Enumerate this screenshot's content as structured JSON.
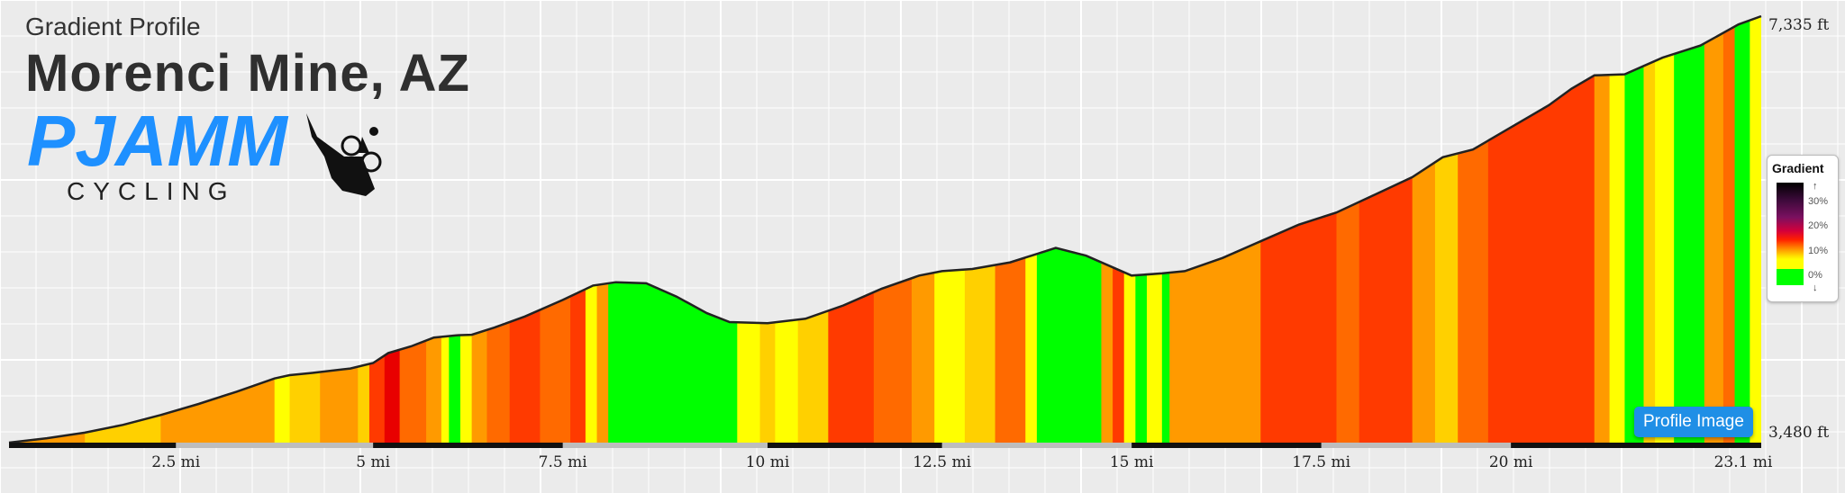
{
  "header": {
    "subtitle": "Gradient Profile",
    "title": "Morenci Mine, AZ"
  },
  "logo": {
    "brand": "PJAMM",
    "tag": "CYCLING"
  },
  "legend": {
    "title": "Gradient",
    "labels": [
      "30%",
      "20%",
      "10%",
      "0%"
    ],
    "up_arrow": "↑",
    "down_arrow": "↓"
  },
  "button": {
    "label": "Profile Image"
  },
  "colors": {
    "background": "#ebebeb",
    "grid": "#ffffff",
    "button": "#1f8fe6",
    "gradient_scale": [
      "#00ff00",
      "#ffff00",
      "#ffd000",
      "#ff9a00",
      "#ff6a00",
      "#ff3a00",
      "#e80000"
    ]
  },
  "chart_data": {
    "type": "area",
    "title": "Morenci Mine, AZ",
    "subtitle": "Gradient Profile",
    "xlabel": "",
    "ylabel": "",
    "x_unit": "mi",
    "y_unit": "ft",
    "xlim": [
      0,
      23.1
    ],
    "ylim": [
      3480,
      7335
    ],
    "x_tick_labels": [
      "2.5 mi",
      "5 mi",
      "7.5 mi",
      "10 mi",
      "12.5 mi",
      "15 mi",
      "17.5 mi",
      "20 mi",
      "23.1 mi"
    ],
    "x_tick_values": [
      2.2,
      4.8,
      7.3,
      10,
      12.3,
      14.8,
      17.3,
      19.8,
      23.1
    ],
    "y_labels": [
      {
        "value": 7335,
        "label": "7,335 ft"
      },
      {
        "value": 3480,
        "label": "3,480 ft"
      }
    ],
    "grid": true,
    "legend_placement": "right",
    "elevation": [
      [
        0.0,
        3480
      ],
      [
        0.5,
        3520
      ],
      [
        1.0,
        3570
      ],
      [
        1.5,
        3640
      ],
      [
        2.0,
        3730
      ],
      [
        2.5,
        3830
      ],
      [
        3.0,
        3940
      ],
      [
        3.5,
        4060
      ],
      [
        3.7,
        4090
      ],
      [
        4.0,
        4110
      ],
      [
        4.5,
        4150
      ],
      [
        4.8,
        4200
      ],
      [
        5.0,
        4290
      ],
      [
        5.3,
        4350
      ],
      [
        5.6,
        4430
      ],
      [
        5.9,
        4450
      ],
      [
        6.1,
        4455
      ],
      [
        6.4,
        4520
      ],
      [
        6.8,
        4620
      ],
      [
        7.3,
        4770
      ],
      [
        7.7,
        4900
      ],
      [
        8.0,
        4930
      ],
      [
        8.4,
        4920
      ],
      [
        8.8,
        4800
      ],
      [
        9.2,
        4650
      ],
      [
        9.5,
        4570
      ],
      [
        10.0,
        4560
      ],
      [
        10.5,
        4600
      ],
      [
        11.0,
        4720
      ],
      [
        11.5,
        4870
      ],
      [
        12.0,
        4990
      ],
      [
        12.3,
        5030
      ],
      [
        12.7,
        5050
      ],
      [
        13.2,
        5110
      ],
      [
        13.8,
        5240
      ],
      [
        14.2,
        5170
      ],
      [
        14.8,
        4990
      ],
      [
        15.2,
        5010
      ],
      [
        15.5,
        5030
      ],
      [
        16.0,
        5150
      ],
      [
        16.5,
        5300
      ],
      [
        17.0,
        5450
      ],
      [
        17.5,
        5560
      ],
      [
        18.0,
        5720
      ],
      [
        18.5,
        5880
      ],
      [
        18.9,
        6060
      ],
      [
        19.3,
        6130
      ],
      [
        19.8,
        6330
      ],
      [
        20.3,
        6530
      ],
      [
        20.6,
        6680
      ],
      [
        20.9,
        6800
      ],
      [
        21.3,
        6810
      ],
      [
        21.8,
        6960
      ],
      [
        22.3,
        7070
      ],
      [
        22.8,
        7260
      ],
      [
        23.1,
        7335
      ]
    ],
    "gradient_segments": [
      [
        0.0,
        1.0,
        3
      ],
      [
        1.0,
        2.0,
        2
      ],
      [
        2.0,
        3.5,
        3
      ],
      [
        3.5,
        3.7,
        1
      ],
      [
        3.7,
        4.1,
        2
      ],
      [
        4.1,
        4.6,
        3
      ],
      [
        4.6,
        4.75,
        2
      ],
      [
        4.75,
        4.95,
        5
      ],
      [
        4.95,
        5.15,
        6
      ],
      [
        5.15,
        5.5,
        4
      ],
      [
        5.5,
        5.7,
        3
      ],
      [
        5.7,
        5.8,
        1
      ],
      [
        5.8,
        5.95,
        0
      ],
      [
        5.95,
        6.1,
        1
      ],
      [
        6.1,
        6.3,
        3
      ],
      [
        6.3,
        6.6,
        4
      ],
      [
        6.6,
        7.0,
        5
      ],
      [
        7.0,
        7.4,
        4
      ],
      [
        7.4,
        7.6,
        5
      ],
      [
        7.6,
        7.75,
        1
      ],
      [
        7.75,
        7.9,
        3
      ],
      [
        7.9,
        9.6,
        0
      ],
      [
        9.6,
        9.9,
        1
      ],
      [
        9.9,
        10.1,
        2
      ],
      [
        10.1,
        10.4,
        1
      ],
      [
        10.4,
        10.8,
        2
      ],
      [
        10.8,
        11.4,
        5
      ],
      [
        11.4,
        11.9,
        4
      ],
      [
        11.9,
        12.2,
        3
      ],
      [
        12.2,
        12.6,
        1
      ],
      [
        12.6,
        13.0,
        2
      ],
      [
        13.0,
        13.4,
        4
      ],
      [
        13.4,
        13.55,
        1
      ],
      [
        13.55,
        14.4,
        0
      ],
      [
        14.4,
        14.55,
        3
      ],
      [
        14.55,
        14.7,
        5
      ],
      [
        14.7,
        14.85,
        1
      ],
      [
        14.85,
        15.0,
        0
      ],
      [
        15.0,
        15.2,
        1
      ],
      [
        15.2,
        15.3,
        0
      ],
      [
        15.3,
        16.5,
        3
      ],
      [
        16.5,
        17.5,
        5
      ],
      [
        17.5,
        17.8,
        4
      ],
      [
        17.8,
        18.5,
        5
      ],
      [
        18.5,
        18.8,
        3
      ],
      [
        18.8,
        19.1,
        2
      ],
      [
        19.1,
        19.5,
        4
      ],
      [
        19.5,
        20.9,
        5
      ],
      [
        20.9,
        21.1,
        3
      ],
      [
        21.1,
        21.3,
        1
      ],
      [
        21.3,
        21.55,
        0
      ],
      [
        21.55,
        21.7,
        2
      ],
      [
        21.7,
        21.95,
        1
      ],
      [
        21.95,
        22.35,
        0
      ],
      [
        22.35,
        22.6,
        3
      ],
      [
        22.6,
        22.75,
        4
      ],
      [
        22.75,
        22.95,
        0
      ],
      [
        22.95,
        23.1,
        1
      ]
    ]
  }
}
